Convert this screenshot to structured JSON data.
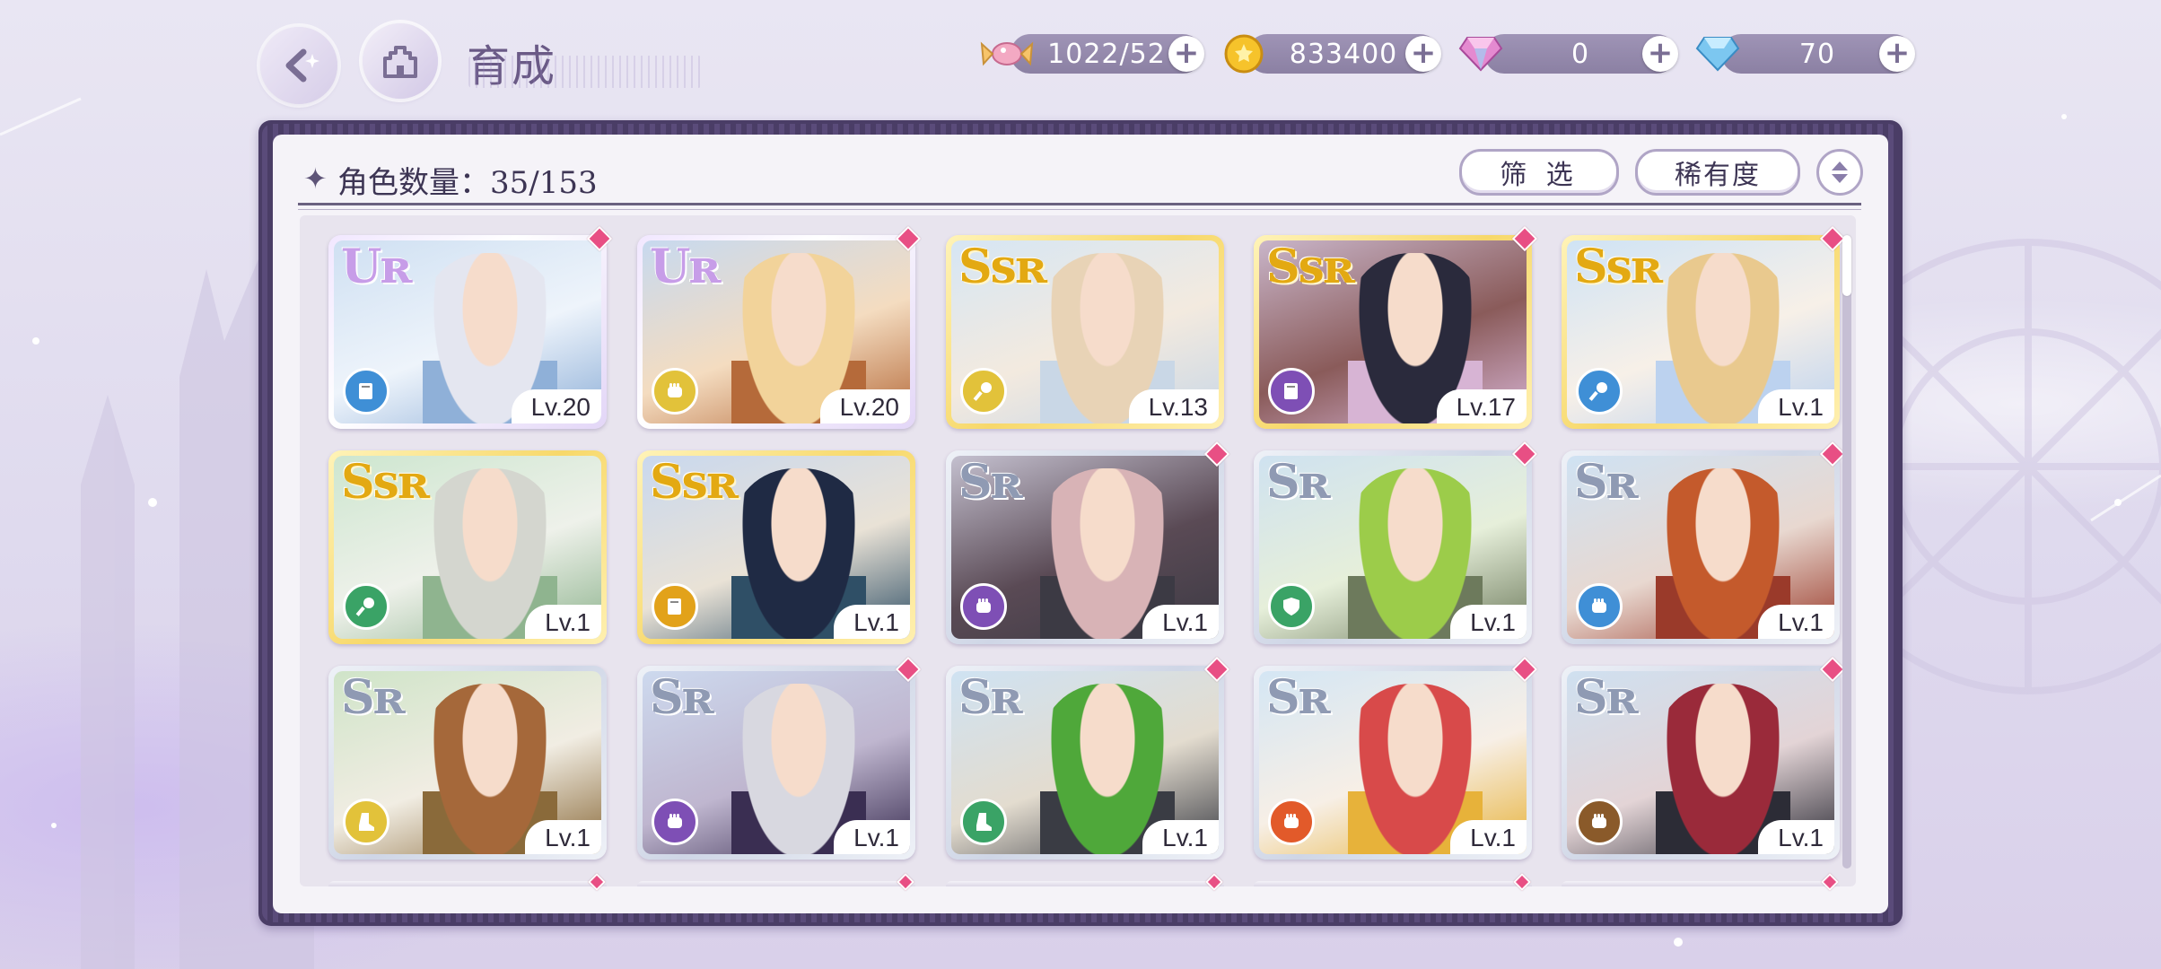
{
  "header": {
    "title": "育成",
    "currencies": [
      {
        "name": "stamina",
        "icon": "candy-icon",
        "value": "1022/52"
      },
      {
        "name": "gold",
        "icon": "gold-coin-icon",
        "value": "833400"
      },
      {
        "name": "paid-gem",
        "icon": "pink-diamond-icon",
        "value": "0"
      },
      {
        "name": "free-gem",
        "icon": "blue-diamond-icon",
        "value": "70"
      }
    ]
  },
  "panel": {
    "count_label": "角色数量：35/153",
    "filter_label": "筛 选",
    "rarity_label": "稀有度"
  },
  "colors": {
    "panel_frame": "#4a3d66",
    "new_badge": "#e84f84"
  },
  "cards": [
    {
      "rank": "UR",
      "level": "Lv.20",
      "role_icon": "book-icon",
      "role_color": "#3f8fd6",
      "new": true,
      "art": [
        "#cfe0f2",
        "#eef4fb",
        "#8fb0d8"
      ],
      "hair": "#e4e6f0"
    },
    {
      "rank": "UR",
      "level": "Lv.20",
      "role_icon": "fist-icon",
      "role_color": "#e2c23a",
      "new": true,
      "art": [
        "#c7d9ef",
        "#f4dcc0",
        "#b56a3a"
      ],
      "hair": "#f2d39a"
    },
    {
      "rank": "SSR",
      "level": "Lv.13",
      "role_icon": "key-icon",
      "role_color": "#e2c23a",
      "new": false,
      "art": [
        "#d6e6f4",
        "#f3eadf",
        "#c9d7e6"
      ],
      "hair": "#e8d3b6"
    },
    {
      "rank": "SSR",
      "level": "Lv.17",
      "role_icon": "book-icon",
      "role_color": "#7e4fb5",
      "new": true,
      "art": [
        "#c9b5c9",
        "#8a5b5a",
        "#d7b4d4"
      ],
      "hair": "#2a2a3c"
    },
    {
      "rank": "SSR",
      "level": "Lv.1",
      "role_icon": "key-icon",
      "role_color": "#3f8fd6",
      "new": true,
      "art": [
        "#cfe3f5",
        "#f7f0e8",
        "#bcd2ef"
      ],
      "hair": "#e9c98e"
    },
    {
      "rank": "SSR",
      "level": "Lv.1",
      "role_icon": "key-icon",
      "role_color": "#3aa366",
      "new": false,
      "art": [
        "#cde6cf",
        "#eef1ea",
        "#8fb48f"
      ],
      "hair": "#d4d6cf"
    },
    {
      "rank": "SSR",
      "level": "Lv.1",
      "role_icon": "book-icon",
      "role_color": "#e2a21a",
      "new": false,
      "art": [
        "#c9d8ee",
        "#e9e2d6",
        "#2f4f66"
      ],
      "hair": "#1f2a44"
    },
    {
      "rank": "SR",
      "level": "Lv.1",
      "role_icon": "fist-icon",
      "role_color": "#7e4fb5",
      "new": true,
      "art": [
        "#c4c0cf",
        "#5a4a55",
        "#3c3a44"
      ],
      "hair": "#d8b3b6"
    },
    {
      "rank": "SR",
      "level": "Lv.1",
      "role_icon": "shield-icon",
      "role_color": "#3aa366",
      "new": true,
      "art": [
        "#cfe2f0",
        "#e6efda",
        "#6d7a5c"
      ],
      "hair": "#9ccc4a"
    },
    {
      "rank": "SR",
      "level": "Lv.1",
      "role_icon": "fist-icon",
      "role_color": "#3f8fd6",
      "new": true,
      "art": [
        "#cfe2f3",
        "#e8d8d0",
        "#9a3a2a"
      ],
      "hair": "#c45a2c"
    },
    {
      "rank": "SR",
      "level": "Lv.1",
      "role_icon": "boot-icon",
      "role_color": "#e2c23a",
      "new": false,
      "art": [
        "#cfe4c8",
        "#f1ede3",
        "#8a6a3a"
      ],
      "hair": "#a5683a"
    },
    {
      "rank": "SR",
      "level": "Lv.1",
      "role_icon": "fist-icon",
      "role_color": "#7e4fb5",
      "new": true,
      "art": [
        "#cdd9ee",
        "#bfb6cf",
        "#3a2e52"
      ],
      "hair": "#d8d8e0"
    },
    {
      "rank": "SR",
      "level": "Lv.1",
      "role_icon": "boot-icon",
      "role_color": "#3aa366",
      "new": true,
      "art": [
        "#cfe2f2",
        "#e3dccf",
        "#3a3c44"
      ],
      "hair": "#4fa83a"
    },
    {
      "rank": "SR",
      "level": "Lv.1",
      "role_icon": "fist-icon",
      "role_color": "#e25a2a",
      "new": true,
      "art": [
        "#d4e6f4",
        "#f7efe6",
        "#e7b23a"
      ],
      "hair": "#d84a4a"
    },
    {
      "rank": "SR",
      "level": "Lv.1",
      "role_icon": "fist-icon",
      "role_color": "#8a5a2a",
      "new": true,
      "art": [
        "#cfe0f0",
        "#e3d4d6",
        "#2c2c36"
      ],
      "hair": "#9a2a3a"
    }
  ]
}
